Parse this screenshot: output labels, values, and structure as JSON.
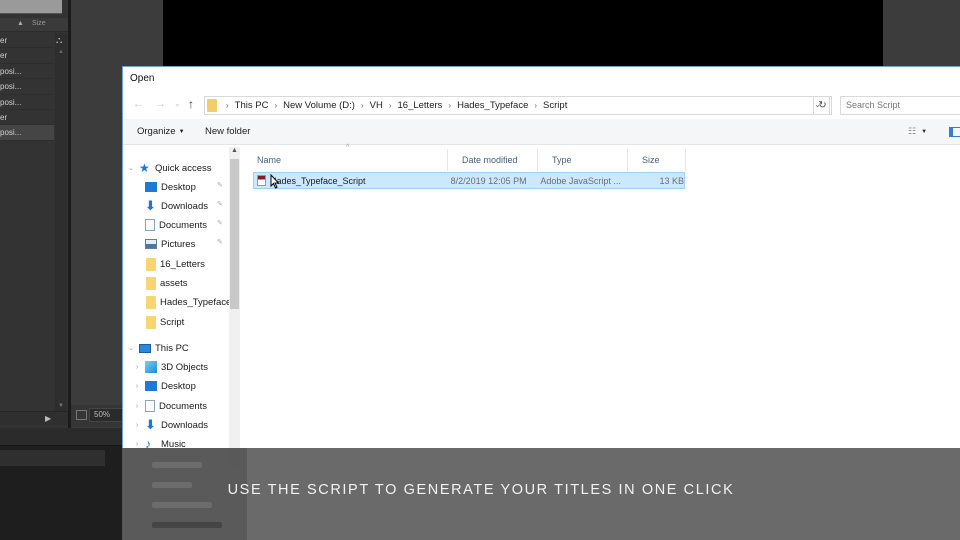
{
  "ae": {
    "project_panel": {
      "size_column": "Size",
      "rows": [
        {
          "label": "er",
          "selected": false
        },
        {
          "label": "er",
          "selected": false
        },
        {
          "label": "posi...",
          "selected": false
        },
        {
          "label": "posi...",
          "selected": false
        },
        {
          "label": "posi...",
          "selected": false
        },
        {
          "label": "er",
          "selected": false
        },
        {
          "label": "posi...",
          "selected": true
        }
      ]
    },
    "comp_viewer": {
      "zoom_level": "50%"
    }
  },
  "dialog": {
    "title": "Open",
    "nav": {
      "back_icon": "←",
      "forward_icon": "→",
      "recent_icon": "⌄",
      "up_icon": "↑"
    },
    "address": {
      "breadcrumbs": [
        "This PC",
        "New Volume (D:)",
        "VH",
        "16_Letters",
        "Hades_Typeface",
        "Script"
      ],
      "separator": "›",
      "dropdown_icon": "⌄",
      "refresh_icon": "↻"
    },
    "search": {
      "placeholder": "Search Script"
    },
    "toolbar": {
      "organize_label": "Organize",
      "organize_caret": "▼",
      "new_folder_label": "New folder",
      "views_icon": "☷",
      "views_caret": "▼"
    },
    "tree": {
      "quick_access": {
        "label": "Quick access",
        "items": [
          {
            "label": "Desktop",
            "icon": "desktop-icon",
            "pinned": true
          },
          {
            "label": "Downloads",
            "icon": "downloads-icon",
            "pinned": true
          },
          {
            "label": "Documents",
            "icon": "documents-icon",
            "pinned": true
          },
          {
            "label": "Pictures",
            "icon": "pictures-icon",
            "pinned": true
          },
          {
            "label": "16_Letters",
            "icon": "folder-icon",
            "pinned": false
          },
          {
            "label": "assets",
            "icon": "folder-icon",
            "pinned": false
          },
          {
            "label": "Hades_Typeface",
            "icon": "folder-icon",
            "pinned": false
          },
          {
            "label": "Script",
            "icon": "folder-icon",
            "pinned": false
          }
        ]
      },
      "this_pc": {
        "label": "This PC",
        "items": [
          {
            "label": "3D Objects",
            "icon": "3d-objects-icon"
          },
          {
            "label": "Desktop",
            "icon": "desktop-icon"
          },
          {
            "label": "Documents",
            "icon": "documents-icon"
          },
          {
            "label": "Downloads",
            "icon": "downloads-icon"
          },
          {
            "label": "Music",
            "icon": "music-icon"
          }
        ]
      },
      "pin_glyph": "✎",
      "expand_glyph": "›",
      "collapse_glyph": "⌄"
    },
    "filelist": {
      "columns": [
        "Name",
        "Date modified",
        "Type",
        "Size"
      ],
      "sort_indicator": "^",
      "rows": [
        {
          "name": "Hades_Typeface_Script",
          "date_modified": "8/2/2019 12:05 PM",
          "type": "Adobe JavaScript ...",
          "size": "13 KB",
          "selected": true
        }
      ]
    }
  },
  "caption": {
    "text": "USE THE SCRIPT TO GENERATE YOUR TITLES IN ONE CLICK"
  }
}
